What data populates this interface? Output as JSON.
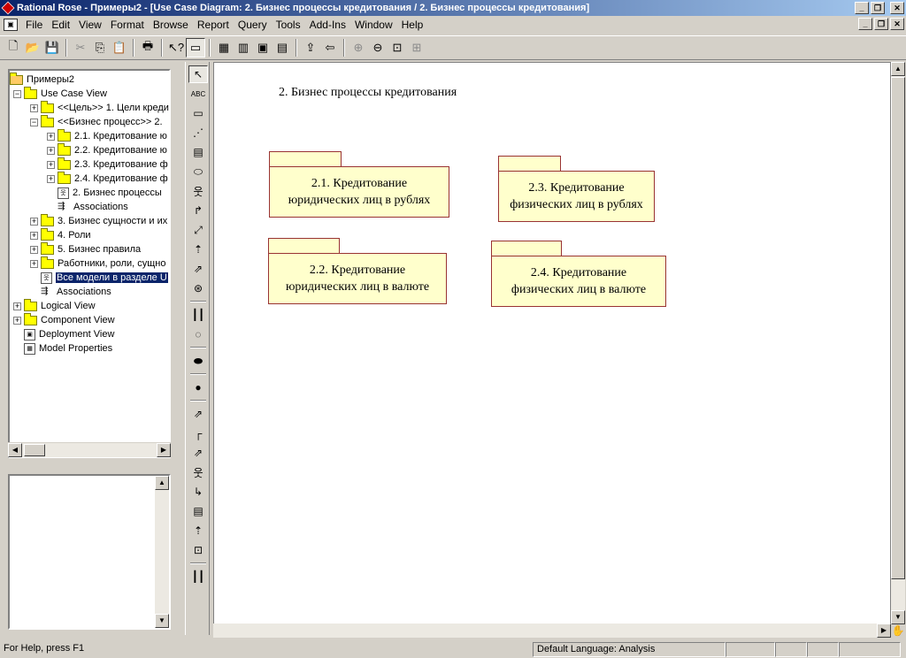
{
  "window": {
    "title": "Rational Rose - Примеры2 - [Use Case Diagram: 2. Бизнес процессы кредитования / 2. Бизнес процессы кредитования]"
  },
  "menu": [
    "File",
    "Edit",
    "View",
    "Format",
    "Browse",
    "Report",
    "Query",
    "Tools",
    "Add-Ins",
    "Window",
    "Help"
  ],
  "toolbar": {
    "icons": [
      "new-icon",
      "open-icon",
      "save-icon",
      "cut-icon",
      "copy-icon",
      "paste-icon",
      "print-icon",
      "context-help-icon",
      "view-doc-icon",
      "browse-class-icon",
      "browse-interaction-icon",
      "browse-component-icon",
      "browse-deployment-icon",
      "browse-parent-icon",
      "browse-previous-icon",
      "zoom-in-icon",
      "zoom-out-icon",
      "fit-window-icon",
      "undo-fit-icon"
    ]
  },
  "tree": {
    "root": "Примеры2",
    "items": [
      {
        "label": "Use Case View",
        "level": 1,
        "expander": "−",
        "icon": "folder"
      },
      {
        "label": "<<Цель>> 1. Цели креди",
        "level": 2,
        "expander": "+",
        "icon": "folder"
      },
      {
        "label": "<<Бизнес процесс>> 2.",
        "level": 2,
        "expander": "−",
        "icon": "folder"
      },
      {
        "label": "2.1. Кредитование ю",
        "level": 3,
        "expander": "+",
        "icon": "folder"
      },
      {
        "label": "2.2. Кредитование ю",
        "level": 3,
        "expander": "+",
        "icon": "folder"
      },
      {
        "label": "2.3. Кредитование ф",
        "level": 3,
        "expander": "+",
        "icon": "folder"
      },
      {
        "label": "2.4. Кредитование ф",
        "level": 3,
        "expander": "+",
        "icon": "folder"
      },
      {
        "label": "2. Бизнес процессы",
        "level": 3,
        "expander": "",
        "icon": "diagram"
      },
      {
        "label": "Associations",
        "level": 3,
        "expander": "",
        "icon": "assoc"
      },
      {
        "label": "3. Бизнес сущности и их",
        "level": 2,
        "expander": "+",
        "icon": "folder"
      },
      {
        "label": "4. Роли",
        "level": 2,
        "expander": "+",
        "icon": "folder"
      },
      {
        "label": "5. Бизнес правила",
        "level": 2,
        "expander": "+",
        "icon": "folder"
      },
      {
        "label": "Работники, роли, сущно",
        "level": 2,
        "expander": "+",
        "icon": "folder"
      },
      {
        "label": "Все модели в разделе U",
        "level": 2,
        "expander": "",
        "icon": "diagram",
        "selected": true
      },
      {
        "label": "Associations",
        "level": 2,
        "expander": "",
        "icon": "assoc"
      },
      {
        "label": "Logical View",
        "level": 1,
        "expander": "+",
        "icon": "folder"
      },
      {
        "label": "Component View",
        "level": 1,
        "expander": "+",
        "icon": "folder"
      },
      {
        "label": "Deployment View",
        "level": 1,
        "expander": "",
        "icon": "deployment"
      },
      {
        "label": "Model Properties",
        "level": 1,
        "expander": "",
        "icon": "properties"
      }
    ]
  },
  "palette": {
    "tools": [
      {
        "name": "selection-tool-icon",
        "glyph": "↖",
        "active": true
      },
      {
        "name": "text-box-icon",
        "glyph": "ABC"
      },
      {
        "name": "note-icon",
        "glyph": "▭"
      },
      {
        "name": "anchor-note-icon",
        "glyph": "⋰"
      },
      {
        "name": "package-icon",
        "glyph": "▤"
      },
      {
        "name": "use-case-icon",
        "glyph": "⬭"
      },
      {
        "name": "actor-icon",
        "glyph": "웃"
      },
      {
        "name": "unidirectional-association-icon",
        "glyph": "↱"
      },
      {
        "name": "dependency-icon",
        "glyph": "⤢"
      },
      {
        "name": "generalization-icon",
        "glyph": "⇡"
      },
      {
        "name": "business-actor-icon",
        "glyph": "⇗"
      },
      {
        "name": "business-use-case-icon",
        "glyph": "⊛"
      },
      {
        "name": "boundary-icon",
        "glyph": "┃┃"
      },
      {
        "name": "business-use-case-realization-icon",
        "glyph": "◌"
      },
      {
        "name": "use-case-realization-icon",
        "glyph": "⬬"
      },
      {
        "name": "business-worker-icon",
        "glyph": "●"
      },
      {
        "name": "realize-icon",
        "glyph": "⇗"
      },
      {
        "name": "association-corner-icon",
        "glyph": "┌"
      },
      {
        "name": "dependency-2-icon",
        "glyph": "⇗"
      },
      {
        "name": "worker-icon",
        "glyph": "웃"
      },
      {
        "name": "generalize-corner-icon",
        "glyph": "↳"
      },
      {
        "name": "entity-icon",
        "glyph": "▤"
      },
      {
        "name": "dependency-dotted-icon",
        "glyph": "⇡"
      },
      {
        "name": "business-entity-icon",
        "glyph": "⊡"
      },
      {
        "name": "separator-bars-icon",
        "glyph": "┃┃"
      }
    ]
  },
  "diagram": {
    "title": "2. Бизнес процессы кредитования",
    "packages": [
      {
        "line1": "2.1. Кредитование",
        "line2": "юридических лиц в рублях"
      },
      {
        "line1": "2.3. Кредитование",
        "line2": "физических лиц в рублях"
      },
      {
        "line1": "2.2. Кредитование",
        "line2": "юридических лиц в валюте"
      },
      {
        "line1": "2.4. Кредитование",
        "line2": "физических лиц в валюте"
      }
    ]
  },
  "status": {
    "help": "For Help, press F1",
    "language": "Default Language: Analysis"
  },
  "colors": {
    "package_fill": "#ffffcc",
    "package_border": "#993333",
    "title_bar": "#0a246a",
    "selection": "#0a246a"
  }
}
